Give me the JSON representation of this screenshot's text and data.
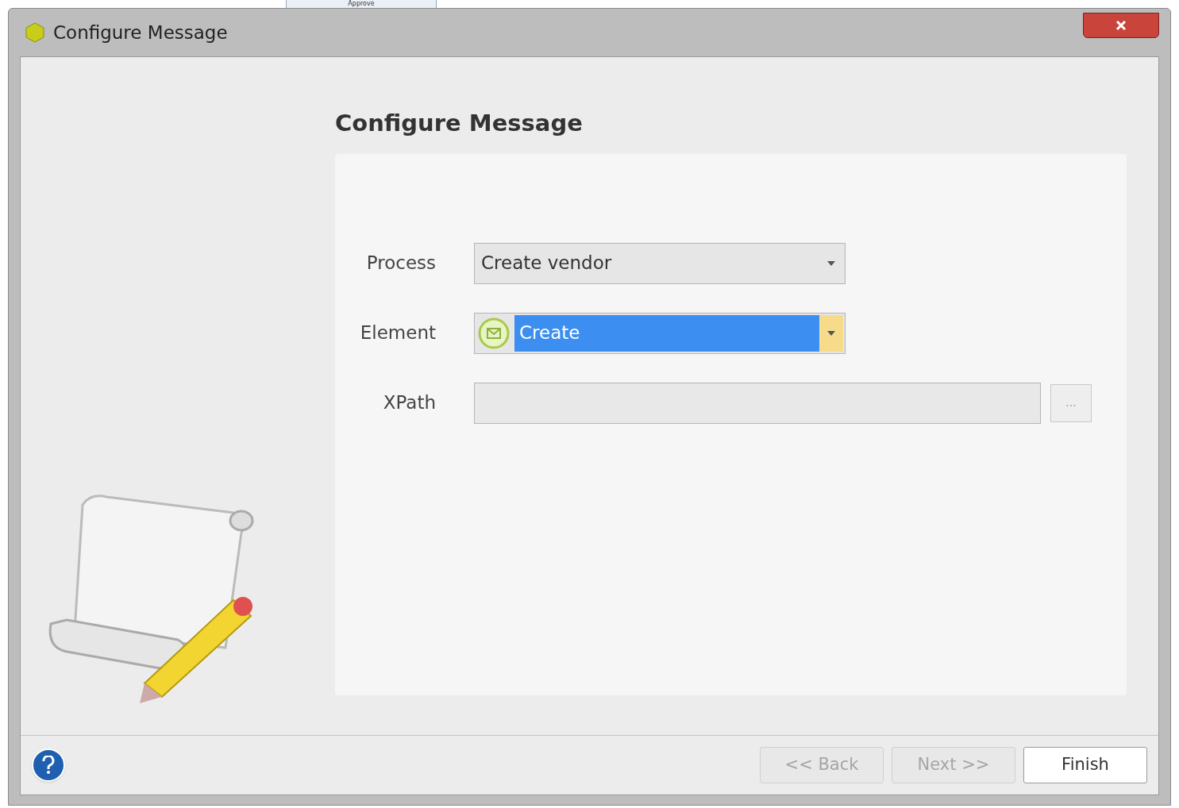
{
  "background": {
    "tab_label": "Approve"
  },
  "window": {
    "title": "Configure Message"
  },
  "heading": "Configure Message",
  "fields": [
    {
      "kind": "dropdown",
      "label": "Process",
      "value": "Create vendor",
      "highlighted": false
    },
    {
      "kind": "icon_dropdown",
      "label": "Element",
      "value": "Create",
      "highlighted": true
    },
    {
      "kind": "browse",
      "label": "XPath",
      "button": "..."
    }
  ],
  "buttons": [
    {
      "label": "<< Back",
      "disabled": true
    },
    {
      "label": "Next >>",
      "disabled": true
    },
    {
      "label": "Finish",
      "disabled": false
    }
  ]
}
